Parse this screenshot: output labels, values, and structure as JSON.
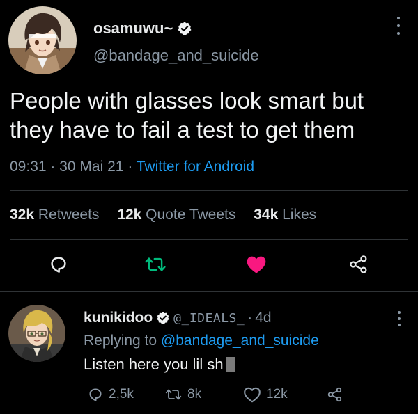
{
  "main_tweet": {
    "display_name": "osamuwu~",
    "handle": "@bandage_and_suicide",
    "text": "People with glasses look smart but they have to fail a test to get them",
    "time": "09:31",
    "date": "30 Mai 21",
    "source": "Twitter for Android",
    "stats": {
      "retweets_count": "32k",
      "retweets_label": "Retweets",
      "quotes_count": "12k",
      "quotes_label": "Quote Tweets",
      "likes_count": "34k",
      "likes_label": "Likes"
    },
    "liked": true
  },
  "reply_tweet": {
    "display_name": "kunikidoo",
    "handle": "@_IDEALS_",
    "age": "4d",
    "replying_prefix": "Replying to",
    "replying_to": "@bandage_and_suicide",
    "text": "Listen here you lil sh",
    "counts": {
      "replies": "2,5k",
      "retweets": "8k",
      "likes": "12k"
    }
  },
  "icons": {
    "verified": "verified-badge-icon",
    "reply": "speech-bubble-icon",
    "retweet": "retweet-arrows-icon",
    "like": "heart-icon",
    "share": "share-nodes-icon",
    "more": "vertical-ellipsis-icon"
  },
  "colors": {
    "background": "#000000",
    "accent_blue": "#1d9bf0",
    "retweet_green": "#00ba7c",
    "like_pink": "#f91880",
    "secondary_text": "#8b98a5",
    "divider": "#2f3336"
  }
}
